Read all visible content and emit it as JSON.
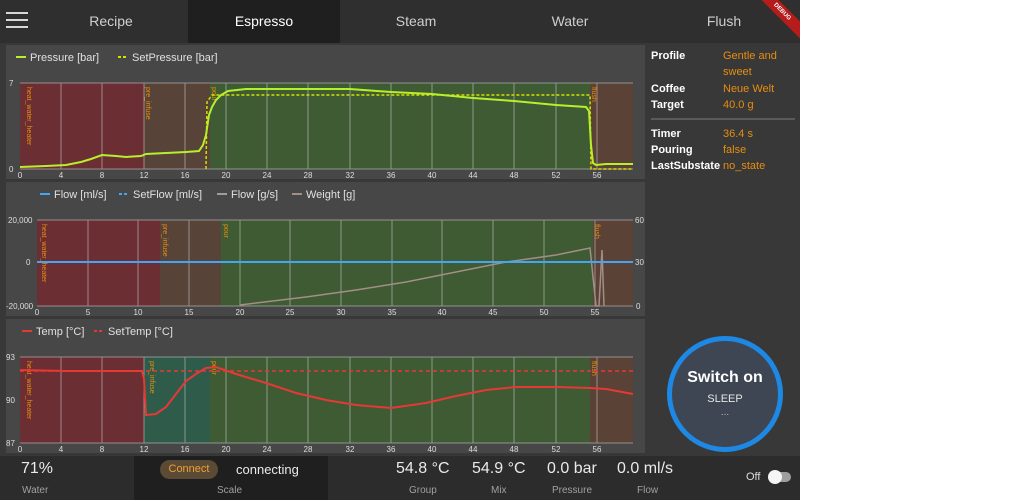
{
  "tabs": [
    "Recipe",
    "Espresso",
    "Steam",
    "Water",
    "Flush"
  ],
  "active_tab": "Espresso",
  "debug_label": "DEBUG",
  "charts": {
    "pressure": {
      "legend": [
        "Pressure [bar]",
        "SetPressure [bar]"
      ],
      "y_ticks": [
        "7",
        "0"
      ],
      "x_ticks": [
        "0",
        "4",
        "8",
        "12",
        "16",
        "20",
        "24",
        "28",
        "32",
        "36",
        "40",
        "44",
        "48",
        "52",
        "56"
      ],
      "phases": [
        "heat_water_heater",
        "pre_infuse",
        "pour",
        "flush"
      ],
      "colors": {
        "pressure": "#b6f02a",
        "set": "#d6e000"
      }
    },
    "flow": {
      "legend": [
        "Flow [ml/s]",
        "SetFlow [ml/s]",
        "Flow [g/s]",
        "Weight [g]"
      ],
      "y_left": [
        "20,000",
        "0",
        "-20,000"
      ],
      "y_right": [
        "60",
        "30",
        "0"
      ],
      "x_ticks": [
        "0",
        "5",
        "10",
        "15",
        "20",
        "25",
        "30",
        "35",
        "40",
        "45",
        "50",
        "55"
      ],
      "phases": [
        "heat_water_heater",
        "pre_infuse",
        "pour",
        "flush"
      ],
      "colors": {
        "flow": "#42a5f5",
        "weight": "#a38e86"
      }
    },
    "temp": {
      "legend": [
        "Temp [°C]",
        "SetTemp [°C]"
      ],
      "y_ticks": [
        "93",
        "90",
        "87"
      ],
      "x_ticks": [
        "0",
        "4",
        "8",
        "12",
        "16",
        "20",
        "24",
        "28",
        "32",
        "36",
        "40",
        "44",
        "48",
        "52",
        "56"
      ],
      "phases": [
        "heat_water_heater",
        "pre_infuse",
        "pour",
        "flush"
      ],
      "colors": {
        "temp": "#e53935"
      }
    }
  },
  "info": {
    "profile_label": "Profile",
    "profile_value": "Gentle and sweet",
    "coffee_label": "Coffee",
    "coffee_value": "Neue Welt",
    "target_label": "Target",
    "target_value": "40.0 g",
    "timer_label": "Timer",
    "timer_value": "36.4 s",
    "pouring_label": "Pouring",
    "pouring_value": "false",
    "substate_label": "LastSubstate",
    "substate_value": "no_state"
  },
  "switch": {
    "title": "Switch on",
    "state": "SLEEP",
    "dots": "..."
  },
  "bottom": {
    "water_value": "71%",
    "water_label": "Water",
    "connect_label": "Connect",
    "scale_status": "connecting",
    "scale_label": "Scale",
    "group_value": "54.8 °C",
    "group_label": "Group",
    "mix_value": "54.9 °C",
    "mix_label": "Mix",
    "pressure_value": "0.0 bar",
    "pressure_label": "Pressure",
    "flow_value": "0.0 ml/s",
    "flow_label": "Flow",
    "off_label": "Off"
  }
}
